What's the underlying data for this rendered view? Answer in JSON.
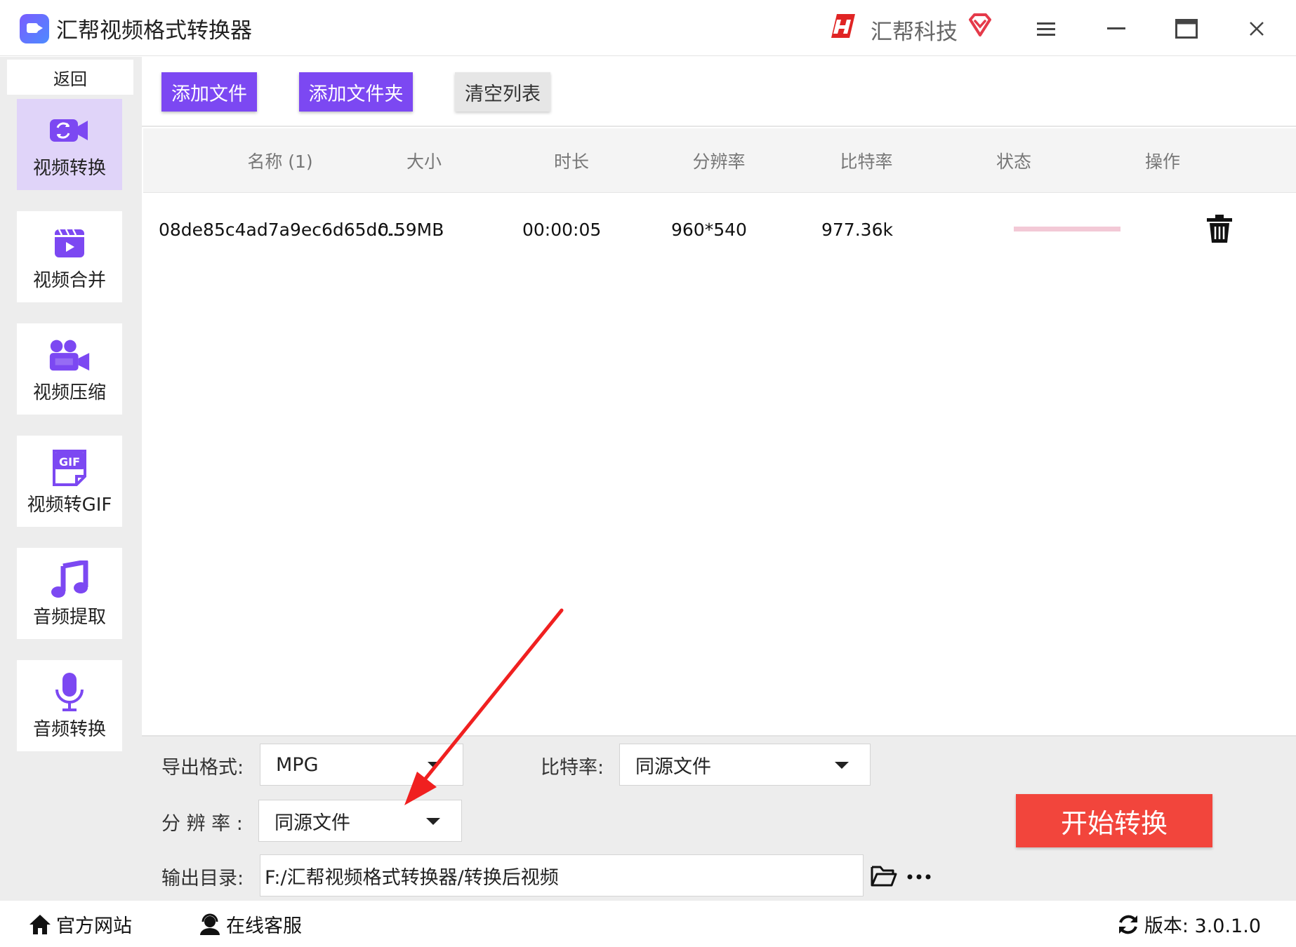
{
  "titlebar": {
    "app_title": "汇帮视频格式转换器",
    "brand_name": "汇帮科技"
  },
  "sidebar": {
    "back_label": "返回",
    "items": [
      {
        "label": "视频转换",
        "icon": "video-convert-icon",
        "active": true
      },
      {
        "label": "视频合并",
        "icon": "video-merge-icon",
        "active": false
      },
      {
        "label": "视频压缩",
        "icon": "video-compress-icon",
        "active": false
      },
      {
        "label": "视频转GIF",
        "icon": "gif-icon",
        "active": false
      },
      {
        "label": "音频提取",
        "icon": "music-note-icon",
        "active": false
      },
      {
        "label": "音频转换",
        "icon": "microphone-icon",
        "active": false
      }
    ]
  },
  "toolbar": {
    "add_file": "添加文件",
    "add_folder": "添加文件夹",
    "clear_list": "清空列表"
  },
  "table": {
    "headers": [
      "名称 (1)",
      "大小",
      "时长",
      "分辨率",
      "比特率",
      "状态",
      "操作"
    ],
    "rows": [
      {
        "name": "08de85c4ad7a9ec6d65dc...",
        "size": "0.59MB",
        "duration": "00:00:05",
        "resolution": "960*540",
        "bitrate": "977.36k"
      }
    ]
  },
  "settings": {
    "format_label": "导出格式:",
    "format_value": "MPG",
    "bitrate_label": "比特率:",
    "bitrate_value": "同源文件",
    "resolution_label": "分 辨 率 :",
    "resolution_value": "同源文件",
    "output_label": "输出目录:",
    "output_path": "F:/汇帮视频格式转换器/转换后视频",
    "start_label": "开始转换"
  },
  "footer": {
    "website": "官方网站",
    "support": "在线客服",
    "version": "版本: 3.0.1.0"
  },
  "colors": {
    "accent": "#7c48f2",
    "active_nav": "#e0d4f9",
    "start_button": "#f2453c",
    "status_bar": "#f3c9d6",
    "annotation_arrow": "#f02020"
  }
}
